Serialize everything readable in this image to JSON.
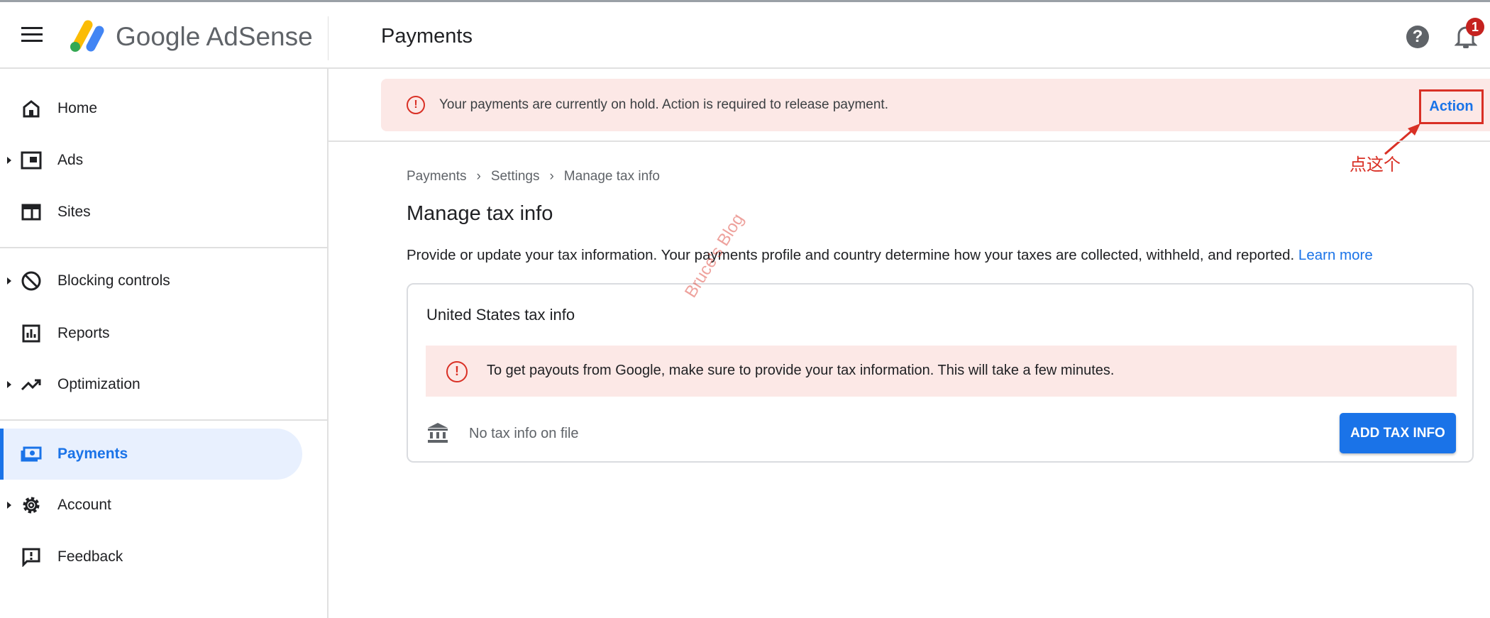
{
  "header": {
    "brand": "Google AdSense",
    "page_title": "Payments",
    "notification_count": "1",
    "help": "?"
  },
  "sidebar": {
    "items": [
      {
        "label": "Home",
        "icon": "home-icon",
        "expandable": false
      },
      {
        "label": "Ads",
        "icon": "ads-icon",
        "expandable": true
      },
      {
        "label": "Sites",
        "icon": "sites-icon",
        "expandable": false
      },
      {
        "label": "Blocking controls",
        "icon": "block-icon",
        "expandable": true
      },
      {
        "label": "Reports",
        "icon": "reports-icon",
        "expandable": false
      },
      {
        "label": "Optimization",
        "icon": "trending-icon",
        "expandable": true
      },
      {
        "label": "Payments",
        "icon": "payments-icon",
        "expandable": false,
        "active": true
      },
      {
        "label": "Account",
        "icon": "gear-icon",
        "expandable": true
      },
      {
        "label": "Feedback",
        "icon": "feedback-icon",
        "expandable": false
      }
    ]
  },
  "banner": {
    "message": "Your payments are currently on hold. Action is required to release payment.",
    "action": "Action"
  },
  "breadcrumb": [
    "Payments",
    "Settings",
    "Manage tax info"
  ],
  "main": {
    "title": "Manage tax info",
    "description": "Provide or update your tax information. Your payments profile and country determine how your taxes are collected, withheld, and reported.",
    "learn_more": "Learn more",
    "card": {
      "title": "United States tax info",
      "alert": "To get payouts from Google, make sure to provide your tax information. This will take a few minutes.",
      "status": "No tax info on file",
      "button": "ADD TAX INFO"
    }
  },
  "annotation": {
    "note": "点这个",
    "watermark": "Bruce's Blog"
  },
  "colors": {
    "accent": "#1a73e8",
    "error": "#d93025",
    "alert_bg": "#fce8e6"
  }
}
